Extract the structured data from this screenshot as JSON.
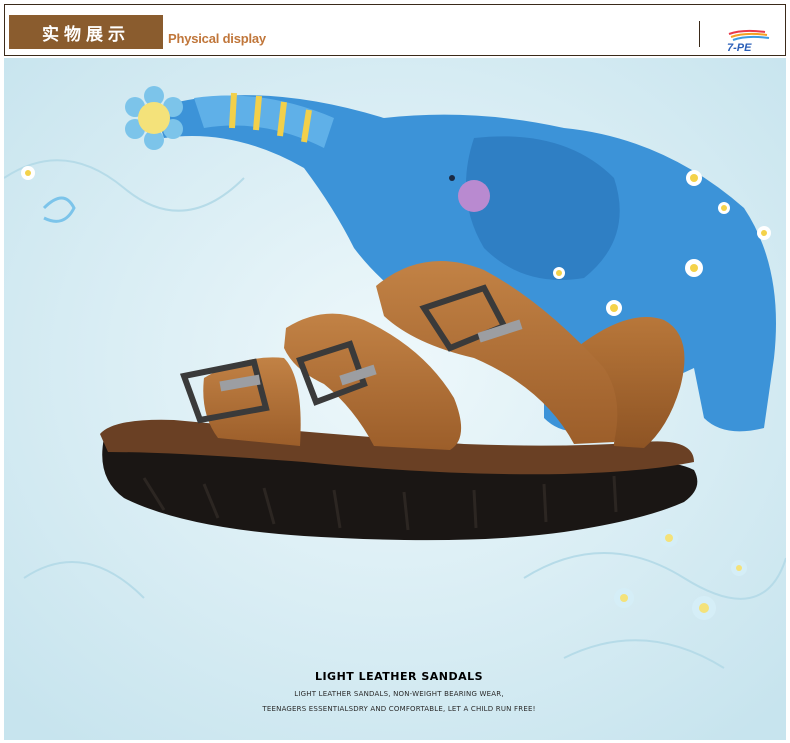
{
  "header": {
    "title_cn": "实物展示",
    "title_en": "Physical display",
    "brand_logo": "7-PE"
  },
  "caption": {
    "title": "LIGHT LEATHER SANDALS",
    "line1": "LIGHT LEATHER SANDALS, NON-WEIGHT BEARING WEAR,",
    "line2": "TEENAGERS ESSENTIALSDRY AND COMFORTABLE, LET A CHILD RUN FREE!"
  },
  "colors": {
    "header_badge": "#8a5c2e",
    "header_text_en": "#c0763a",
    "background": "#dff0f6",
    "elephant_blue": "#3c93d8",
    "sandal_leather": "#a5662e",
    "sole": "#1a1614"
  }
}
